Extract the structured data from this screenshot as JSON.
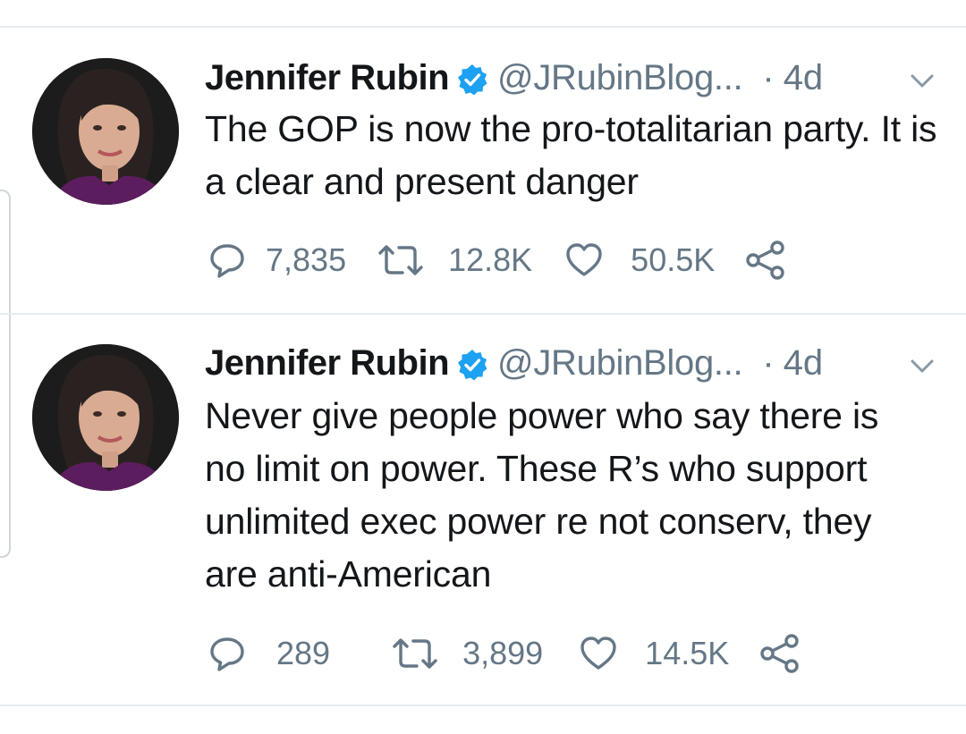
{
  "tweets": [
    {
      "author_name": "Jennifer Rubin",
      "verified": true,
      "handle": "@JRubinBlog...",
      "separator": "·",
      "time": "4d",
      "text": "The GOP is now the pro-totalitarian party. It is a clear and present danger",
      "replies": "7,835",
      "retweets": "12.8K",
      "likes": "50.5K"
    },
    {
      "author_name": "Jennifer Rubin",
      "verified": true,
      "handle": "@JRubinBlog...",
      "separator": "·",
      "time": "4d",
      "text": "Never give people power who say there is no limit on power. These R’s who support unlimited exec power re not conserv, they are anti-American",
      "replies": "289",
      "retweets": "3,899",
      "likes": "14.5K"
    }
  ],
  "colors": {
    "text_primary": "#14171a",
    "text_secondary": "#657786",
    "verified_badge": "#1da1f2",
    "divider": "#e6ecf0"
  },
  "icons": [
    "verified-badge-icon",
    "chevron-down-icon",
    "reply-icon",
    "retweet-icon",
    "like-icon",
    "share-icon"
  ]
}
